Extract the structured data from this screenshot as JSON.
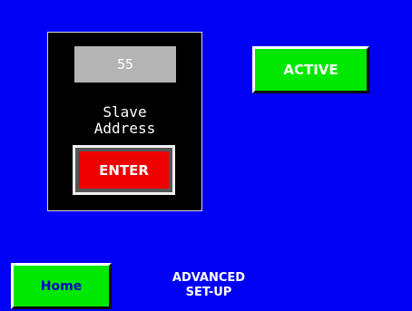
{
  "slave_address": {
    "value": "55",
    "label_line1": "Slave",
    "label_line2": "Address",
    "enter_label": "ENTER"
  },
  "status_button": {
    "label": "ACTIVE"
  },
  "footer": {
    "home_label": "Home",
    "title_line1": "ADVANCED",
    "title_line2": "SET-UP"
  },
  "colors": {
    "background": "#0000f5",
    "panel": "#000000",
    "display": "#b4b4b4",
    "enter": "#ee0000",
    "active": "#00e800",
    "home_text": "#0000cc"
  }
}
